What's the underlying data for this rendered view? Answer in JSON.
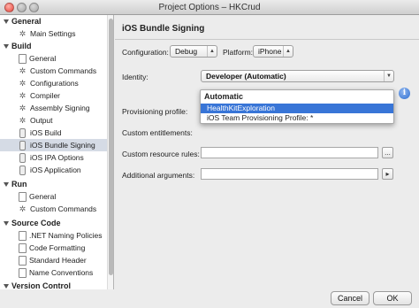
{
  "window": {
    "title": "Project Options – HKCrud"
  },
  "sidebar": {
    "categories": [
      {
        "label": "General"
      },
      {
        "label": "Build"
      },
      {
        "label": "Run"
      },
      {
        "label": "Source Code"
      },
      {
        "label": "Version Control"
      }
    ],
    "items": [
      {
        "label": "Main Settings",
        "icon": "gear-icon"
      },
      {
        "label": "General",
        "icon": "document-icon"
      },
      {
        "label": "Custom Commands",
        "icon": "gear-icon"
      },
      {
        "label": "Configurations",
        "icon": "gear-icon"
      },
      {
        "label": "Compiler",
        "icon": "gear-icon"
      },
      {
        "label": "Assembly Signing",
        "icon": "gear-icon"
      },
      {
        "label": "Output",
        "icon": "gear-icon"
      },
      {
        "label": "iOS Build",
        "icon": "phone-icon"
      },
      {
        "label": "iOS Bundle Signing",
        "icon": "phone-icon",
        "selected": true
      },
      {
        "label": "iOS IPA Options",
        "icon": "phone-icon"
      },
      {
        "label": "iOS Application",
        "icon": "phone-icon"
      },
      {
        "label": "General",
        "icon": "document-icon"
      },
      {
        "label": "Custom Commands",
        "icon": "gear-icon"
      },
      {
        "label": ".NET Naming Policies",
        "icon": "document-icon"
      },
      {
        "label": "Code Formatting",
        "icon": "document-icon"
      },
      {
        "label": "Standard Header",
        "icon": "document-icon"
      },
      {
        "label": "Name Conventions",
        "icon": "document-icon"
      }
    ]
  },
  "main": {
    "title": "iOS Bundle Signing",
    "configuration_label": "Configuration:",
    "configuration_value": "Debug",
    "platform_label": "Platform:",
    "platform_value": "iPhone",
    "identity_label": "Identity:",
    "identity_value": "Developer (Automatic)",
    "provisioning_label": "Provisioning profile:",
    "entitlements_label": "Custom entitlements:",
    "resource_rules_label": "Custom resource rules:",
    "additional_args_label": "Additional arguments:",
    "browse_label": "...",
    "run_label": "▸"
  },
  "dropdown": {
    "header": "Automatic",
    "options": [
      {
        "label": "HealthKitExploration",
        "highlighted": true
      },
      {
        "label": "iOS Team Provisioning Profile: *"
      }
    ]
  },
  "buttons": {
    "cancel": "Cancel",
    "ok": "OK"
  },
  "colors": {
    "highlight": "#3875d7",
    "selection": "#d5dbe5",
    "info": "#2f6fd0"
  }
}
